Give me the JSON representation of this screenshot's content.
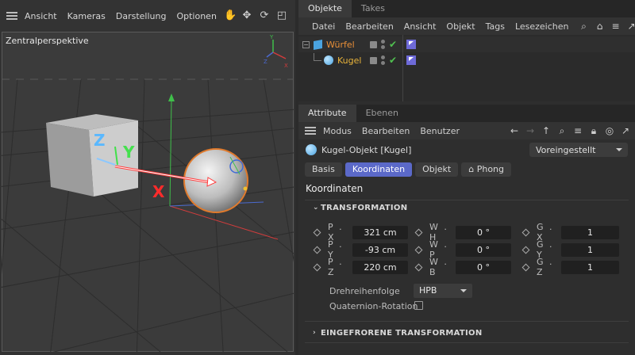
{
  "viewport": {
    "menu": [
      "Ansicht",
      "Kameras",
      "Darstellung",
      "Optionen",
      ">"
    ],
    "tools": [
      "hand-icon",
      "move-arrows-icon",
      "rotate-icon",
      "maximize-icon"
    ],
    "camera_label": "Zentralperspektive",
    "axis_labels": {
      "x": "X",
      "y": "Y",
      "z": "Z"
    }
  },
  "objects": {
    "tabs": [
      "Objekte",
      "Takes"
    ],
    "menu": [
      "Datei",
      "Bearbeiten",
      "Ansicht",
      "Objekt",
      "Tags",
      "Lesezeichen"
    ],
    "items": [
      {
        "name": "Würfel",
        "color": "#e98f38"
      },
      {
        "name": "Kugel",
        "color": "#e8b33a"
      }
    ]
  },
  "attributes": {
    "tabs": [
      "Attribute",
      "Ebenen"
    ],
    "menu": [
      "Modus",
      "Bearbeiten",
      "Benutzer"
    ],
    "object_title": "Kugel-Objekt [Kugel]",
    "preset": "Voreingestellt",
    "subtabs": [
      "Basis",
      "Koordinaten",
      "Objekt",
      "Phong"
    ],
    "active_subtab": "Koordinaten",
    "section_title": "Koordinaten",
    "group_transformation": "TRANSFORMATION",
    "rows": [
      {
        "p_label": "P . X",
        "p_val": "321 cm",
        "w_label": "W . H",
        "w_val": "0 °",
        "g_label": "G . X",
        "g_val": "1"
      },
      {
        "p_label": "P . Y",
        "p_val": "-93 cm",
        "w_label": "W . P",
        "w_val": "0 °",
        "g_label": "G . Y",
        "g_val": "1"
      },
      {
        "p_label": "P . Z",
        "p_val": "220 cm",
        "w_label": "W . B",
        "w_val": "0 °",
        "g_label": "G . Z",
        "g_val": "1"
      }
    ],
    "rotation_order_label": "Drehreihenfolge",
    "rotation_order_value": "HPB",
    "quaternion_label": "Quaternion-Rotation",
    "group_frozen": "EINGEFRORENE TRANSFORMATION"
  },
  "colors": {
    "accent": "#5b69c9",
    "cube": "#e98f38",
    "sphere": "#e8b33a",
    "check": "#50c050"
  }
}
